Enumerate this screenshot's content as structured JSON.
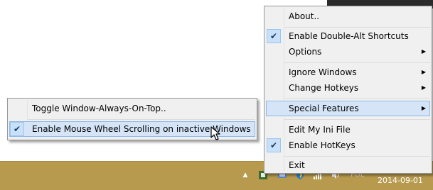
{
  "main_menu": {
    "items": [
      {
        "label": "About..",
        "checked": false,
        "submenu": false
      },
      {
        "label": "Enable Double-Alt Shortcuts",
        "checked": true,
        "submenu": false
      },
      {
        "label": "Options",
        "checked": false,
        "submenu": true
      },
      {
        "label": "Ignore Windows",
        "checked": false,
        "submenu": true
      },
      {
        "label": "Change Hotkeys",
        "checked": false,
        "submenu": true
      },
      {
        "label": "Special Features",
        "checked": false,
        "submenu": true,
        "highlighted": true
      },
      {
        "label": "Edit My Ini File",
        "checked": false,
        "submenu": false
      },
      {
        "label": "Enable HotKeys",
        "checked": true,
        "submenu": false
      },
      {
        "label": "Exit",
        "checked": false,
        "submenu": false
      }
    ]
  },
  "sub_menu": {
    "items": [
      {
        "label": "Toggle Window-Always-On-Top..",
        "checked": false
      },
      {
        "label": "Enable Mouse Wheel Scrolling on inactive Windows",
        "checked": true,
        "highlighted": true
      }
    ]
  },
  "icons": {
    "check": "✔",
    "submenu_arrow": "▶",
    "tray_expand": "▲"
  },
  "taskbar": {
    "language": "POL",
    "date": "2014-09-01"
  },
  "colors": {
    "taskbar": "#b89a4e",
    "menu_bg": "#f0f0f0",
    "highlight": "#d5e5f7",
    "highlight_border": "#8eb8e6"
  }
}
